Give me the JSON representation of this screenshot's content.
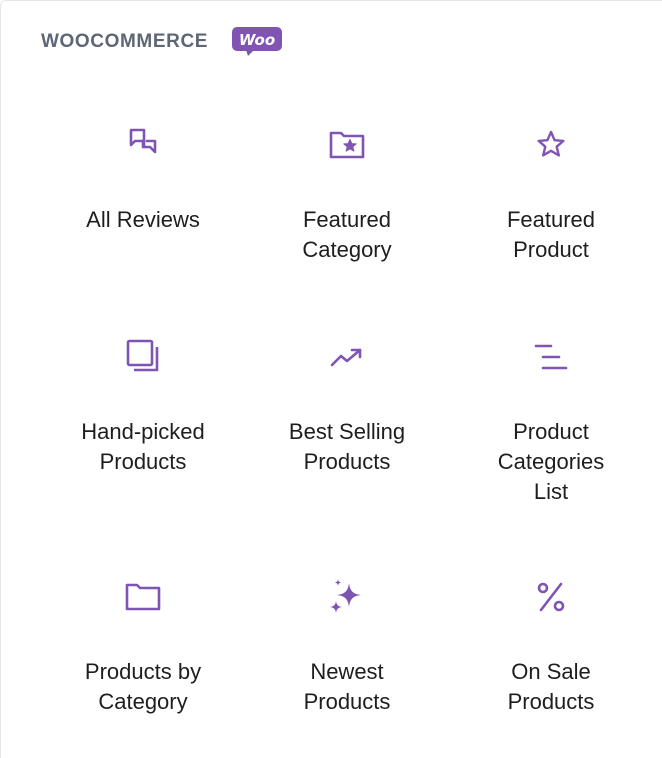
{
  "section": {
    "title": "WOOCOMMERCE",
    "logo_text": "Woo"
  },
  "colors": {
    "accent": "#7f54b3",
    "title": "#5e6775",
    "text": "#1e1e1e"
  },
  "blocks": [
    {
      "label": "All Reviews",
      "icon": "reviews-icon"
    },
    {
      "label": "Featured\nCategory",
      "icon": "folder-star-icon"
    },
    {
      "label": "Featured\nProduct",
      "icon": "star-icon"
    },
    {
      "label": "Hand-picked\nProducts",
      "icon": "stack-icon"
    },
    {
      "label": "Best Selling\nProducts",
      "icon": "trending-up-icon"
    },
    {
      "label": "Product\nCategories\nList",
      "icon": "list-icon"
    },
    {
      "label": "Products by\nCategory",
      "icon": "folder-icon"
    },
    {
      "label": "Newest\nProducts",
      "icon": "sparkles-icon"
    },
    {
      "label": "On Sale\nProducts",
      "icon": "percent-icon"
    }
  ]
}
